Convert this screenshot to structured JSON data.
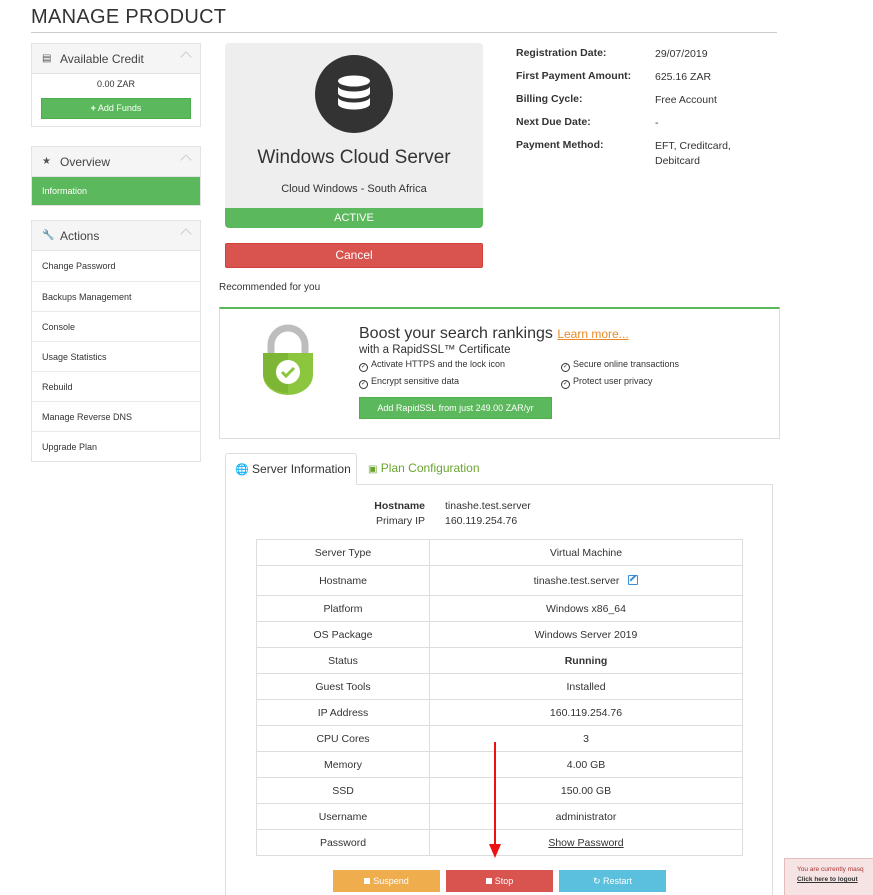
{
  "page": {
    "title": "MANAGE PRODUCT"
  },
  "sidebar": {
    "credit": {
      "title": "Available Credit",
      "value": "0.00 ZAR",
      "add_funds": "Add Funds"
    },
    "overview": {
      "title": "Overview",
      "active_item": "Information"
    },
    "actions": {
      "title": "Actions",
      "items": [
        "Change Password",
        "Backups Management",
        "Console",
        "Usage Statistics",
        "Rebuild",
        "Manage Reverse DNS",
        "Upgrade Plan"
      ]
    }
  },
  "product": {
    "name": "Windows Cloud Server",
    "group": "Cloud Windows - South Africa",
    "status": "ACTIVE",
    "cancel_label": "Cancel"
  },
  "billing": {
    "rows": [
      {
        "label": "Registration Date:",
        "value": "29/07/2019"
      },
      {
        "label": "First Payment Amount:",
        "value": "625.16 ZAR"
      },
      {
        "label": "Billing Cycle:",
        "value": "Free Account"
      },
      {
        "label": "Next Due Date:",
        "value": "-"
      },
      {
        "label": "Payment Method:",
        "value": "EFT, Creditcard, Debitcard"
      }
    ]
  },
  "recommended": {
    "heading": "Recommended for you",
    "title": "Boost your search rankings",
    "learn_more": "Learn more...",
    "subtitle": "with a RapidSSL™ Certificate",
    "features": [
      "Activate HTTPS and the lock icon",
      "Secure online transactions",
      "Encrypt sensitive data",
      "Protect user privacy"
    ],
    "button": "Add RapidSSL from just 249.00 ZAR/yr"
  },
  "tabs": {
    "server_info": "Server Information",
    "plan_config": "Plan Configuration"
  },
  "server": {
    "hostname_label": "Hostname",
    "hostname": "tinashe.test.server",
    "primary_ip_label": "Primary IP",
    "primary_ip": "160.119.254.76",
    "table": [
      {
        "label": "Server Type",
        "value": "Virtual Machine"
      },
      {
        "label": "Hostname",
        "value": "tinashe.test.server"
      },
      {
        "label": "Platform",
        "value": "Windows x86_64"
      },
      {
        "label": "OS Package",
        "value": "Windows Server 2019"
      },
      {
        "label": "Status",
        "value": "Running"
      },
      {
        "label": "Guest Tools",
        "value": "Installed"
      },
      {
        "label": "IP Address",
        "value": "160.119.254.76"
      },
      {
        "label": "CPU Cores",
        "value": "3"
      },
      {
        "label": "Memory",
        "value": "4.00 GB"
      },
      {
        "label": "SSD",
        "value": "150.00 GB"
      },
      {
        "label": "Username",
        "value": "administrator"
      },
      {
        "label": "Password",
        "value": "Show Password"
      }
    ],
    "buttons": {
      "suspend": "Suspend",
      "stop": "Stop",
      "restart": "Restart"
    }
  },
  "masquerade": {
    "text": "You are currently masq",
    "link": "Click here to logout"
  },
  "colors": {
    "green": "#5cb85c",
    "red": "#d9534f",
    "orange": "#f0ad4e",
    "blue": "#5bc0de",
    "annotation_arrow": "#ee1111"
  }
}
